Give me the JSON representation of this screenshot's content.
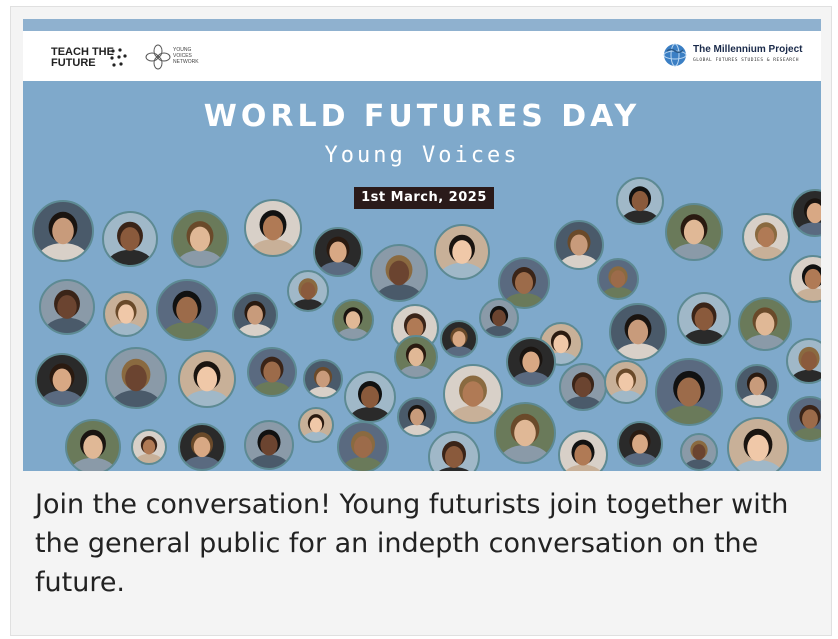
{
  "banner": {
    "left_logo_text_line1": "TEACH THE",
    "left_logo_text_line2": "FUTURE",
    "young_voices_line1": "YOUNG",
    "young_voices_line2": "VOICES",
    "young_voices_line3": "NETWORK",
    "partner_name": "The Millennium Project",
    "partner_tagline": "GLOBAL FUTURES STUDIES & RESEARCH",
    "title": "WORLD FUTURES DAY",
    "subtitle": "Young Voices",
    "date": "1st March, 2025"
  },
  "caption": "Join the conversation! Young futurists join together with the general public for an indepth conversation on the future.",
  "colors": {
    "banner_bg": "#7fa9cb",
    "ring": "#5d8a93",
    "date_bg": "#2a1a1a",
    "text": "#222222"
  }
}
